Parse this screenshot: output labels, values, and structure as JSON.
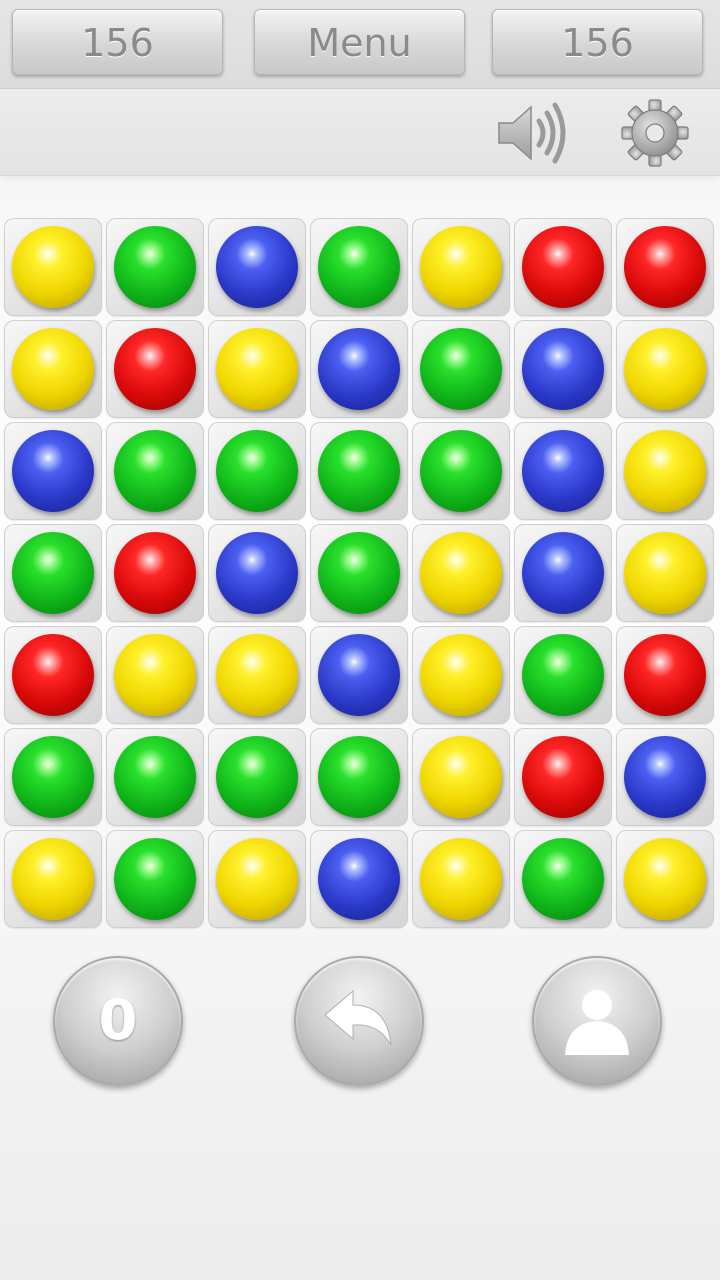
{
  "top_bar": {
    "left_score": "156",
    "menu_label": "Menu",
    "right_score": "156"
  },
  "toolbar": {
    "icons": [
      "speaker-icon",
      "gear-icon"
    ]
  },
  "board": {
    "rows": 7,
    "cols": 7,
    "grid": [
      [
        "yellow",
        "green",
        "blue",
        "green",
        "yellow",
        "red",
        "red"
      ],
      [
        "yellow",
        "red",
        "yellow",
        "blue",
        "green",
        "blue",
        "yellow"
      ],
      [
        "blue",
        "green",
        "green",
        "green",
        "green",
        "blue",
        "yellow"
      ],
      [
        "green",
        "red",
        "blue",
        "green",
        "yellow",
        "blue",
        "yellow"
      ],
      [
        "red",
        "yellow",
        "yellow",
        "blue",
        "yellow",
        "green",
        "red"
      ],
      [
        "green",
        "green",
        "green",
        "green",
        "yellow",
        "red",
        "blue"
      ],
      [
        "yellow",
        "green",
        "yellow",
        "blue",
        "yellow",
        "green",
        "yellow"
      ]
    ],
    "colors": {
      "yellow": "#f2d800",
      "green": "#12b81c",
      "blue": "#2b3acb",
      "red": "#dc0808"
    }
  },
  "bottom": {
    "score": "0",
    "icons": [
      "undo-icon",
      "profile-icon"
    ]
  }
}
